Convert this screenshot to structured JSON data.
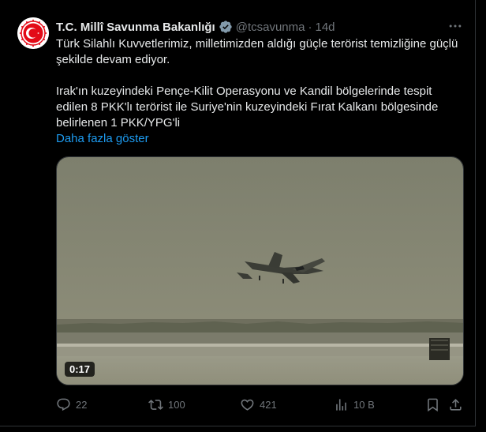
{
  "tweet": {
    "author_name": "T.C. Millî Savunma Bakanlığı",
    "handle": "@tcsavunma",
    "separator": "·",
    "time": "14d",
    "text_p1": "Türk Silahlı Kuvvetlerimiz, milletimizden aldığı güçle terörist temizliğine güçlü şekilde devam ediyor.",
    "text_p2": "Irak'ın kuzeyindeki Pençe-Kilit Operasyonu ve Kandil bölgelerinde tespit edilen 8 PKK'lı terörist ile Suriye'nin kuzeyindeki Fırat Kalkanı bölgesinde belirlenen 1 PKK/YPG'li",
    "show_more": "Daha fazla göster",
    "video_duration": "0:17"
  },
  "actions": {
    "replies": "22",
    "reposts": "100",
    "likes": "421",
    "views": "10 B"
  },
  "colors": {
    "background": "#000000",
    "text": "#e7e9ea",
    "muted": "#71767b",
    "link": "#1d9bf0",
    "verified": "#829aab",
    "logo_red": "#e30a17"
  },
  "icons": {
    "avatar": "msb-emblem",
    "verified": "verified-badge-icon",
    "more": "more-dots-icon",
    "reply": "reply-icon",
    "repost": "repost-icon",
    "like": "heart-icon",
    "views": "views-chart-icon",
    "bookmark": "bookmark-icon",
    "share": "share-icon"
  }
}
